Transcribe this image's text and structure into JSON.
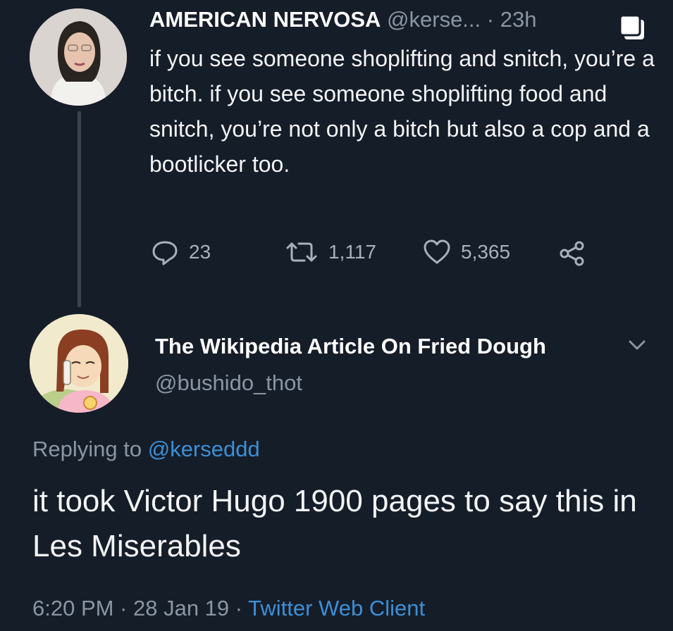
{
  "tweet1": {
    "display_name": "AMERICAN NERVOSA",
    "handle": "@kerse...",
    "separator": " · ",
    "time": "23h",
    "text": "if you see someone shoplifting and snitch, you’re a bitch. if you see someone shoplifting food and snitch, you’re not only a bitch but also a cop and a bootlicker too.",
    "replies": "23",
    "retweets": "1,117",
    "likes": "5,365"
  },
  "tweet2": {
    "display_name": "The Wikipedia Article On Fried Dough",
    "handle": "@bushido_thot",
    "replying_prefix": "Replying to ",
    "replying_to": "@kerseddd",
    "text": "it took Victor Hugo 1900 pages to say this in Les Miserables",
    "timestamp": "6:20 PM · 28 Jan 19 · ",
    "client": "Twitter Web Client"
  },
  "colors": {
    "background": "#151d29",
    "text": "#f2f4f6",
    "muted": "#8a96a3",
    "link": "#3d8fd6"
  },
  "icons": [
    "reply-icon",
    "retweet-icon",
    "like-icon",
    "share-icon",
    "chevron-down-icon",
    "copy-icon"
  ]
}
